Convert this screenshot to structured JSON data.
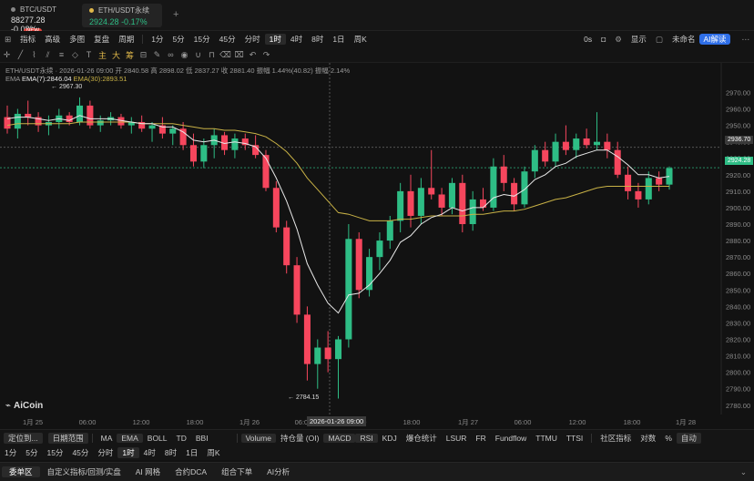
{
  "tabs": [
    {
      "symbol": "BTC/USDT",
      "price": "88277.28",
      "change": "-0.08%"
    },
    {
      "symbol": "ETH/USDT永续",
      "price": "2924.28",
      "change": "-0.17%"
    }
  ],
  "toolbar": {
    "new_badge": "NEW",
    "items": [
      "指标",
      "高级",
      "多图",
      "复盘",
      "周期",
      "1分",
      "5分",
      "15分",
      "45分",
      "分时",
      "1时",
      "4时",
      "8时",
      "1日",
      "周K"
    ],
    "right": [
      "0s",
      "显示",
      "未命名",
      "AI解读"
    ]
  },
  "tools": {
    "zhu": "主",
    "da": "大",
    "chou": "筹"
  },
  "chart_info": {
    "line1": "ETH/USDT永续 · 2026-01-26 09:00  开 2840.58  高 2898.02  低 2837.27  收 2881.40  振幅 1.44%(40.82)  振幅 2.14%",
    "ema_label": "EMA",
    "ema7": "EMA(7):2846.04",
    "ema30": "EMA(30):2893.51",
    "high_annot": "← 2967.30",
    "low_annot": "← 2784.15",
    "crosshair_price": "2936.70",
    "last_price": "2924.28",
    "crosshair_time": "2026-01-26 09:00",
    "logo": "AiCoin"
  },
  "colors": {
    "up": "#2ebd85",
    "down": "#f6465d",
    "ema7": "#e8e8e8",
    "ema30": "#c9b246",
    "bg": "#121212"
  },
  "chart_data": {
    "type": "candlestick",
    "title": "ETH/USDT永续",
    "y_ticks": [
      2970,
      2960,
      2950,
      2940,
      2930,
      2920,
      2910,
      2900,
      2890,
      2880,
      2870,
      2860,
      2850,
      2840,
      2830,
      2820,
      2810,
      2800,
      2790,
      2780
    ],
    "ylim": [
      2776,
      2978
    ],
    "x_labels": [
      "1月 25",
      "06:00",
      "12:00",
      "18:00",
      "1月 26",
      "06:00",
      "12:00",
      "18:00",
      "1月 27",
      "06:00",
      "12:00",
      "18:00",
      "1月 28"
    ],
    "candles": [
      [
        2955,
        2962,
        2945,
        2948
      ],
      [
        2948,
        2960,
        2942,
        2957
      ],
      [
        2957,
        2965,
        2950,
        2955
      ],
      [
        2955,
        2958,
        2946,
        2950
      ],
      [
        2950,
        2956,
        2944,
        2952
      ],
      [
        2952,
        2960,
        2948,
        2956
      ],
      [
        2956,
        2958,
        2950,
        2952
      ],
      [
        2952,
        2967,
        2950,
        2962
      ],
      [
        2962,
        2965,
        2948,
        2950
      ],
      [
        2950,
        2956,
        2946,
        2953
      ],
      [
        2953,
        2958,
        2950,
        2955
      ],
      [
        2955,
        2957,
        2948,
        2950
      ],
      [
        2950,
        2955,
        2945,
        2952
      ],
      [
        2952,
        2956,
        2946,
        2948
      ],
      [
        2948,
        2952,
        2940,
        2950
      ],
      [
        2950,
        2955,
        2942,
        2945
      ],
      [
        2945,
        2950,
        2938,
        2948
      ],
      [
        2948,
        2952,
        2935,
        2938
      ],
      [
        2938,
        2945,
        2925,
        2928
      ],
      [
        2928,
        2942,
        2924,
        2938
      ],
      [
        2938,
        2948,
        2930,
        2944
      ],
      [
        2944,
        2946,
        2932,
        2935
      ],
      [
        2935,
        2945,
        2930,
        2942
      ],
      [
        2942,
        2945,
        2935,
        2938
      ],
      [
        2938,
        2944,
        2930,
        2932
      ],
      [
        2932,
        2935,
        2910,
        2912
      ],
      [
        2912,
        2916,
        2885,
        2888
      ],
      [
        2888,
        2892,
        2860,
        2865
      ],
      [
        2865,
        2870,
        2830,
        2835
      ],
      [
        2835,
        2840,
        2795,
        2805
      ],
      [
        2805,
        2820,
        2790,
        2815
      ],
      [
        2815,
        2825,
        2800,
        2808
      ],
      [
        2808,
        2822,
        2784,
        2820
      ],
      [
        2820,
        2890,
        2815,
        2881
      ],
      [
        2881,
        2885,
        2845,
        2850
      ],
      [
        2850,
        2875,
        2846,
        2870
      ],
      [
        2870,
        2885,
        2862,
        2880
      ],
      [
        2880,
        2895,
        2875,
        2892
      ],
      [
        2892,
        2915,
        2885,
        2910
      ],
      [
        2910,
        2920,
        2888,
        2895
      ],
      [
        2895,
        2918,
        2890,
        2912
      ],
      [
        2912,
        2935,
        2905,
        2908
      ],
      [
        2908,
        2912,
        2895,
        2900
      ],
      [
        2900,
        2918,
        2896,
        2915
      ],
      [
        2915,
        2920,
        2885,
        2890
      ],
      [
        2890,
        2910,
        2886,
        2905
      ],
      [
        2905,
        2912,
        2898,
        2900
      ],
      [
        2900,
        2930,
        2898,
        2925
      ],
      [
        2925,
        2932,
        2910,
        2915
      ],
      [
        2915,
        2918,
        2898,
        2902
      ],
      [
        2902,
        2925,
        2900,
        2922
      ],
      [
        2922,
        2938,
        2918,
        2935
      ],
      [
        2935,
        2940,
        2925,
        2928
      ],
      [
        2928,
        2945,
        2925,
        2940
      ],
      [
        2940,
        2950,
        2932,
        2935
      ],
      [
        2935,
        2945,
        2930,
        2942
      ],
      [
        2942,
        2948,
        2936,
        2938
      ],
      [
        2938,
        2958,
        2935,
        2940
      ],
      [
        2940,
        2945,
        2930,
        2935
      ],
      [
        2935,
        2940,
        2918,
        2920
      ],
      [
        2920,
        2925,
        2905,
        2910
      ],
      [
        2910,
        2915,
        2900,
        2905
      ],
      [
        2905,
        2922,
        2902,
        2918
      ],
      [
        2918,
        2922,
        2910,
        2914
      ],
      [
        2914,
        2925,
        2911,
        2924
      ]
    ],
    "ema7": [
      2954,
      2955,
      2955,
      2954,
      2953,
      2954,
      2953,
      2956,
      2954,
      2954,
      2954,
      2953,
      2952,
      2951,
      2951,
      2949,
      2949,
      2946,
      2941,
      2940,
      2941,
      2939,
      2940,
      2939,
      2937,
      2930,
      2918,
      2904,
      2887,
      2866,
      2853,
      2842,
      2836,
      2847,
      2848,
      2853,
      2860,
      2868,
      2879,
      2883,
      2890,
      2894,
      2896,
      2900,
      2898,
      2900,
      2900,
      2906,
      2908,
      2907,
      2911,
      2917,
      2920,
      2925,
      2927,
      2931,
      2933,
      2935,
      2935,
      2931,
      2926,
      2920,
      2920,
      2918,
      2919
    ],
    "ema30": [
      2950,
      2951,
      2951,
      2951,
      2951,
      2951,
      2951,
      2952,
      2952,
      2952,
      2952,
      2952,
      2952,
      2951,
      2951,
      2951,
      2951,
      2950,
      2949,
      2948,
      2948,
      2947,
      2947,
      2946,
      2945,
      2943,
      2939,
      2934,
      2927,
      2918,
      2911,
      2904,
      2897,
      2896,
      2894,
      2892,
      2892,
      2892,
      2893,
      2893,
      2894,
      2895,
      2895,
      2895,
      2895,
      2896,
      2896,
      2897,
      2898,
      2898,
      2899,
      2901,
      2903,
      2905,
      2906,
      2908,
      2910,
      2912,
      2913,
      2913,
      2913,
      2913,
      2913,
      2913,
      2913
    ]
  },
  "indicators": {
    "date_range": "日期范围",
    "locate": "定位到...",
    "main": [
      "MA",
      "EMA",
      "BOLL",
      "TD",
      "BBI"
    ],
    "sub": [
      "Volume",
      "持仓量 (OI)",
      "MACD",
      "RSI",
      "KDJ",
      "爆仓统计",
      "LSUR",
      "FR",
      "Fundflow",
      "TTMU",
      "TTSI"
    ],
    "right": [
      "社区指标",
      "对数",
      "%",
      "自动"
    ]
  },
  "periods": [
    "1分",
    "5分",
    "15分",
    "45分",
    "分时",
    "1时",
    "4时",
    "8时",
    "1日",
    "周K"
  ],
  "bottom_tabs": [
    "委单区",
    "自定义指标/回测/实盘",
    "AI 网格",
    "合约DCA",
    "组合下单",
    "AI分析"
  ]
}
